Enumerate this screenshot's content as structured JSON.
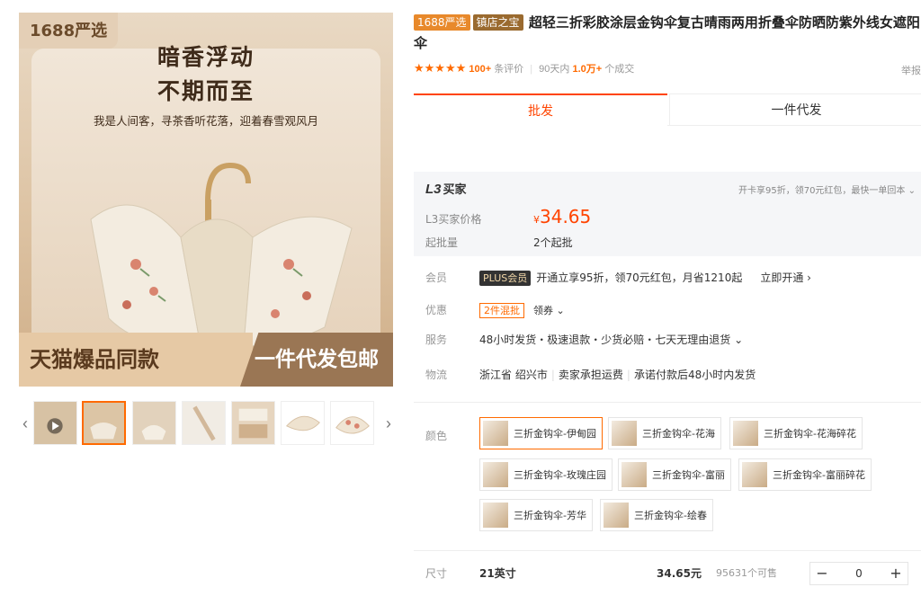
{
  "gallery": {
    "brand_tag": "1688严选",
    "headline_1": "暗香浮动",
    "headline_2": "不期而至",
    "slogan": "我是人间客，寻茶香听花落，迎着春雪观风月",
    "banner_left": "天猫爆品同款",
    "banner_right": "一件代发包邮",
    "thumb_prev": "‹",
    "thumb_next": "›"
  },
  "product": {
    "badge_1": "1688严选",
    "badge_2": "镇店之宝",
    "title": "超轻三折彩胶涂层金钩伞复古晴雨两用折叠伞防晒防紫外线女遮阳伞"
  },
  "rating": {
    "stars": "★★★★★",
    "review_count": "100+",
    "review_label": "条评价",
    "days_label": "90天内",
    "deal_count": "1.0万+",
    "deal_label": "个成交",
    "report": "举报"
  },
  "tabs": [
    {
      "label": "批发"
    },
    {
      "label": "一件代发"
    }
  ],
  "price_box": {
    "level": "L3",
    "level_suffix": "买家",
    "perk": "开卡享95折，领70元红包，最快一单回本 ⌄",
    "price_label": "L3买家价格",
    "currency": "¥",
    "price": "34.65",
    "moq_label": "起批量",
    "moq_value": "2个起批"
  },
  "attrs": {
    "member_label": "会员",
    "plus_badge": "PLUS会员",
    "member_text": "开通立享95折，领70元红包，月省1210起",
    "member_link": "立即开通 ›",
    "promo_label": "优惠",
    "mix_badge": "2件混批",
    "coupon": "领券 ⌄",
    "service_label": "服务",
    "service_text": "48小时发货・极速退款・少货必赔・七天无理由退货 ⌄",
    "logistics_label": "物流",
    "logistics_1": "浙江省 绍兴市",
    "logistics_2": "卖家承担运费",
    "logistics_3": "承诺付款后48小时内发货"
  },
  "colors": {
    "label": "颜色",
    "options": [
      "三折金钩伞-伊甸园",
      "三折金钩伞-花海",
      "三折金钩伞-花海碎花",
      "三折金钩伞-玫瑰庄园",
      "三折金钩伞-富丽",
      "三折金钩伞-富丽碎花",
      "三折金钩伞-芳华",
      "三折金钩伞-绘春"
    ]
  },
  "size": {
    "label": "尺寸",
    "value": "21英寸",
    "price": "34.65元",
    "stock": "95631个可售",
    "qty": "0",
    "minus": "−",
    "plus": "+"
  },
  "theme": {
    "accent": "#ff4400",
    "accent_light": "#ff6a00"
  }
}
